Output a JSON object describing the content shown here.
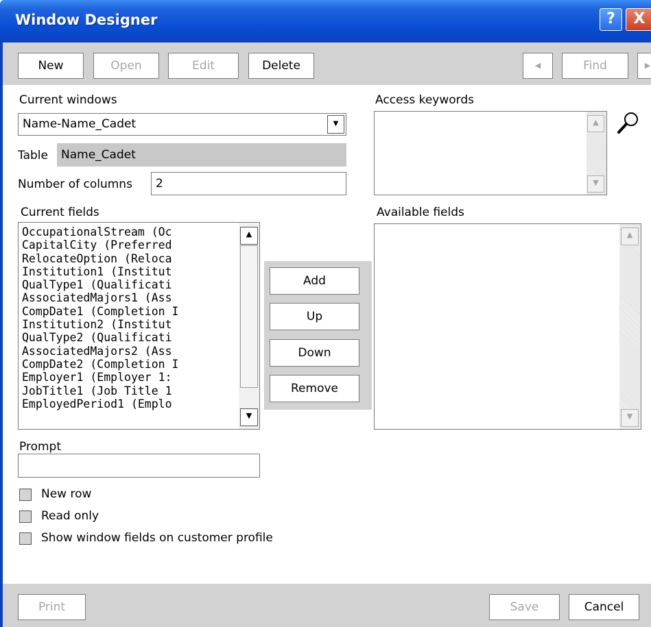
{
  "window": {
    "title": "Window Designer",
    "help_glyph": "?",
    "close_glyph": "X"
  },
  "toolbar": {
    "new_label": "New",
    "open_label": "Open",
    "edit_label": "Edit",
    "delete_label": "Delete",
    "prev_glyph": "◀",
    "find_label": "Find",
    "next_glyph": "▶"
  },
  "form": {
    "current_windows_label": "Current windows",
    "current_windows_value": "Name-Name_Cadet",
    "table_label": "Table",
    "table_value": "Name_Cadet",
    "num_columns_label": "Number of columns",
    "num_columns_value": "2",
    "access_keywords_label": "Access keywords",
    "current_fields_label": "Current fields",
    "available_fields_label": "Available fields",
    "prompt_label": "Prompt",
    "prompt_value": ""
  },
  "current_fields": [
    "OccupationalStream (Oc",
    "CapitalCity (Preferred",
    "RelocateOption (Reloca",
    "Institution1 (Institut",
    "QualType1 (Qualificati",
    "AssociatedMajors1 (Ass",
    "CompDate1 (Completion I",
    "Institution2 (Institut",
    "QualType2 (Qualificati",
    "AssociatedMajors2 (Ass",
    "CompDate2 (Completion I",
    "Employer1 (Employer 1:",
    "JobTitle1 (Job Title 1",
    "EmployedPeriod1 (Emplo"
  ],
  "actions": {
    "add_label": "Add",
    "up_label": "Up",
    "down_label": "Down",
    "remove_label": "Remove"
  },
  "options": {
    "new_row_label": "New row",
    "new_row_checked": false,
    "read_only_label": "Read only",
    "read_only_checked": false,
    "show_profile_label": "Show window fields on customer profile",
    "show_profile_checked": false
  },
  "footer": {
    "print_label": "Print",
    "save_label": "Save",
    "cancel_label": "Cancel"
  },
  "colors": {
    "titlebar": "#0a4fd6",
    "panel_gray": "#d2d2d2",
    "disabled_text": "#a6a6a6"
  }
}
